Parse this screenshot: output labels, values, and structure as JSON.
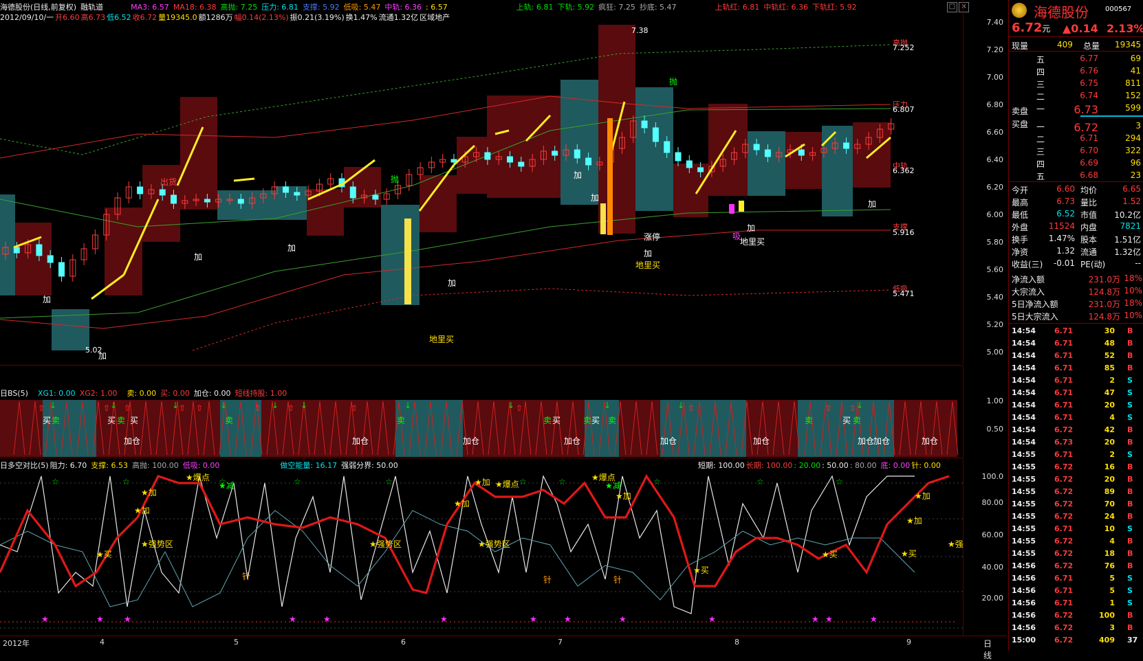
{
  "header": {
    "stock": "海德股份(日线,前复权)",
    "indicator": "融轨道",
    "ma3": "MA3: 6.57",
    "ma18": "MA18: 6.38",
    "gaopao": "高抛: 7.25",
    "yali": "压力: 6.81",
    "zhicheng": "支撑: 5.92",
    "dixi": "低吸: 5.47",
    "zhonggui": "中轨: 6.36",
    "last": ": 6.57",
    "shanggui": "上轨: 6.81",
    "xiagui": "下轨: 5.92",
    "fengkuang": "疯狂: 7.25",
    "chaodi": "抄底: 5.47",
    "shangguihong": "上轨红: 6.81",
    "zhongguihong": "中轨红: 6.36",
    "xiaguihong": "下轨红: 5.92",
    "line2_date": "2012/09/10/一",
    "line2_open": "开6.60",
    "line2_high": "高6.73",
    "line2_low": "低6.52",
    "line2_close": "收6.72",
    "line2_vol": "量19345.0",
    "line2_amt": "额1286万",
    "line2_chg": "幅0.14(2.13%)",
    "line2_amp": "振0.21(3.19%)",
    "line2_turn": "换1.47%",
    "line2_float": "流通1.32亿",
    "line2_region": "区域地产"
  },
  "main_axis": [
    "7.40",
    "7.20",
    "7.00",
    "6.80",
    "6.60",
    "6.40",
    "6.20",
    "6.00",
    "5.80",
    "5.60",
    "5.40",
    "5.20",
    "5.00"
  ],
  "main_labels": {
    "gaopao_lbl": "高抛",
    "gaopao_val": "7.252",
    "yali_lbl": "压力",
    "yali_val": "6.807",
    "zhonggui_lbl": "中轨",
    "zhonggui_val": "6.362",
    "zhicheng_lbl": "支撑",
    "zhicheng_val": "5.916",
    "dixi_lbl": "低吸",
    "dixi_val": "5.471",
    "peak": "7.38",
    "trough": "5.02",
    "chuhuo": "出货",
    "pao": "抛",
    "zhangting": "涨停",
    "xi": "吸",
    "dilimai": "地里买",
    "jia": "加"
  },
  "bs_panel": {
    "title": "日BS(5)",
    "xg1": "XG1: 0.00",
    "xg2": "XG2: 1.00",
    "mai_sell": "卖: 0.00",
    "mai_buy": "买: 0.00",
    "jiacang": "加仓: 0.00",
    "duanxian": "短线持股: 1.00",
    "axis": [
      "1.00",
      "0.50"
    ],
    "buy_label": "买",
    "sell_label": "卖",
    "add_label": "加仓"
  },
  "osc_panel": {
    "title": "日多空对比(5)",
    "zuli": "阻力: 6.70",
    "zhicheng": "支撑: 6.53",
    "gaopao": "高抛: 100.00",
    "dixi": "低吸: 0.00",
    "zuokong": "做空能量: 16.17",
    "qiangruo": "强弱分界: 50.00",
    "duanqi": "短期: 100.00",
    "changqi": "长期: 100.00",
    "v20": ": 20.00",
    "v50": ": 50.00",
    "v80": ": 80.00",
    "di": "底: 0.00",
    "zhen": "针: 0.00",
    "axis": [
      "100.0",
      "80.00",
      "60.00",
      "40.00",
      "20.00"
    ],
    "lbl_jia": "★加",
    "lbl_mai": "★买",
    "lbl_qiang": "★强势区",
    "lbl_baodian": "★爆点",
    "lbl_jian": "★减",
    "lbl_zhen": "针"
  },
  "x_axis": {
    "year": "2012年",
    "months": [
      "4",
      "5",
      "6",
      "7",
      "8",
      "9"
    ],
    "period": "日线"
  },
  "quote": {
    "name": "海德股份",
    "code": "000567",
    "price": "6.72",
    "unit": "元",
    "change": "▲0.14",
    "pct": "2.13%",
    "xianliang_lbl": "现量",
    "xianliang": "409",
    "zongliang_lbl": "总量",
    "zongliang": "19345",
    "sell_levels": [
      {
        "lvl": "五",
        "price": "6.77",
        "vol": "69"
      },
      {
        "lvl": "四",
        "price": "6.76",
        "vol": "41"
      },
      {
        "lvl": "三",
        "price": "6.75",
        "vol": "811"
      },
      {
        "lvl": "二",
        "price": "6.74",
        "vol": "152"
      },
      {
        "lvl": "一",
        "price": "6.73",
        "vol": "599"
      }
    ],
    "buy_levels": [
      {
        "lvl": "一",
        "price": "6.72",
        "vol": "3"
      },
      {
        "lvl": "二",
        "price": "6.71",
        "vol": "294"
      },
      {
        "lvl": "三",
        "price": "6.70",
        "vol": "322"
      },
      {
        "lvl": "四",
        "price": "6.69",
        "vol": "96"
      },
      {
        "lvl": "五",
        "price": "6.68",
        "vol": "23"
      }
    ],
    "maipan_sell": "卖盘",
    "maipan_buy": "买盘",
    "stats": [
      {
        "l1": "今开",
        "v1": "6.60",
        "c1": "red",
        "l2": "均价",
        "v2": "6.65",
        "c2": "red"
      },
      {
        "l1": "最高",
        "v1": "6.73",
        "c1": "red",
        "l2": "量比",
        "v2": "1.52",
        "c2": "red"
      },
      {
        "l1": "最低",
        "v1": "6.52",
        "c1": "cyan",
        "l2": "市值",
        "v2": "10.2亿",
        "c2": "white"
      },
      {
        "l1": "外盘",
        "v1": "11524",
        "c1": "red",
        "l2": "内盘",
        "v2": "7821",
        "c2": "cyan"
      },
      {
        "l1": "换手",
        "v1": "1.47%",
        "c1": "white",
        "l2": "股本",
        "v2": "1.51亿",
        "c2": "white"
      },
      {
        "l1": "净资",
        "v1": "1.32",
        "c1": "white",
        "l2": "流通",
        "v2": "1.32亿",
        "c2": "white"
      },
      {
        "l1": "收益(三)",
        "v1": "-0.01",
        "c1": "white",
        "l2": "PE(动)",
        "v2": "--",
        "c2": "white"
      }
    ],
    "flows": [
      {
        "l": "净流入额",
        "v": "231.0万",
        "p": "18%"
      },
      {
        "l": "大宗流入",
        "v": "124.8万",
        "p": "10%"
      },
      {
        "l": "5日净流入额",
        "v": "231.0万",
        "p": "18%"
      },
      {
        "l": "5日大宗流入",
        "v": "124.8万",
        "p": "10%"
      }
    ],
    "ticks": [
      {
        "t": "14:54",
        "p": "6.71",
        "v": "30",
        "s": "B"
      },
      {
        "t": "14:54",
        "p": "6.71",
        "v": "48",
        "s": "B"
      },
      {
        "t": "14:54",
        "p": "6.71",
        "v": "52",
        "s": "B"
      },
      {
        "t": "14:54",
        "p": "6.71",
        "v": "85",
        "s": "B"
      },
      {
        "t": "14:54",
        "p": "6.71",
        "v": "2",
        "s": "S"
      },
      {
        "t": "14:54",
        "p": "6.71",
        "v": "47",
        "s": "S"
      },
      {
        "t": "14:54",
        "p": "6.71",
        "v": "20",
        "s": "S"
      },
      {
        "t": "14:54",
        "p": "6.71",
        "v": "4",
        "s": "S"
      },
      {
        "t": "14:54",
        "p": "6.72",
        "v": "42",
        "s": "B"
      },
      {
        "t": "14:54",
        "p": "6.73",
        "v": "20",
        "s": "B"
      },
      {
        "t": "14:55",
        "p": "6.71",
        "v": "2",
        "s": "S"
      },
      {
        "t": "14:55",
        "p": "6.72",
        "v": "16",
        "s": "B"
      },
      {
        "t": "14:55",
        "p": "6.72",
        "v": "20",
        "s": "B"
      },
      {
        "t": "14:55",
        "p": "6.72",
        "v": "89",
        "s": "B"
      },
      {
        "t": "14:55",
        "p": "6.72",
        "v": "70",
        "s": "B"
      },
      {
        "t": "14:55",
        "p": "6.72",
        "v": "24",
        "s": "B"
      },
      {
        "t": "14:55",
        "p": "6.71",
        "v": "10",
        "s": "S"
      },
      {
        "t": "14:55",
        "p": "6.72",
        "v": "4",
        "s": "B"
      },
      {
        "t": "14:55",
        "p": "6.72",
        "v": "18",
        "s": "B"
      },
      {
        "t": "14:56",
        "p": "6.72",
        "v": "76",
        "s": "B"
      },
      {
        "t": "14:56",
        "p": "6.71",
        "v": "5",
        "s": "S"
      },
      {
        "t": "14:56",
        "p": "6.71",
        "v": "5",
        "s": "S"
      },
      {
        "t": "14:56",
        "p": "6.71",
        "v": "1",
        "s": "S"
      },
      {
        "t": "14:56",
        "p": "6.72",
        "v": "100",
        "s": "B"
      },
      {
        "t": "14:56",
        "p": "6.72",
        "v": "3",
        "s": "B"
      },
      {
        "t": "15:00",
        "p": "6.72",
        "v": "409",
        "s": "37"
      }
    ]
  }
}
